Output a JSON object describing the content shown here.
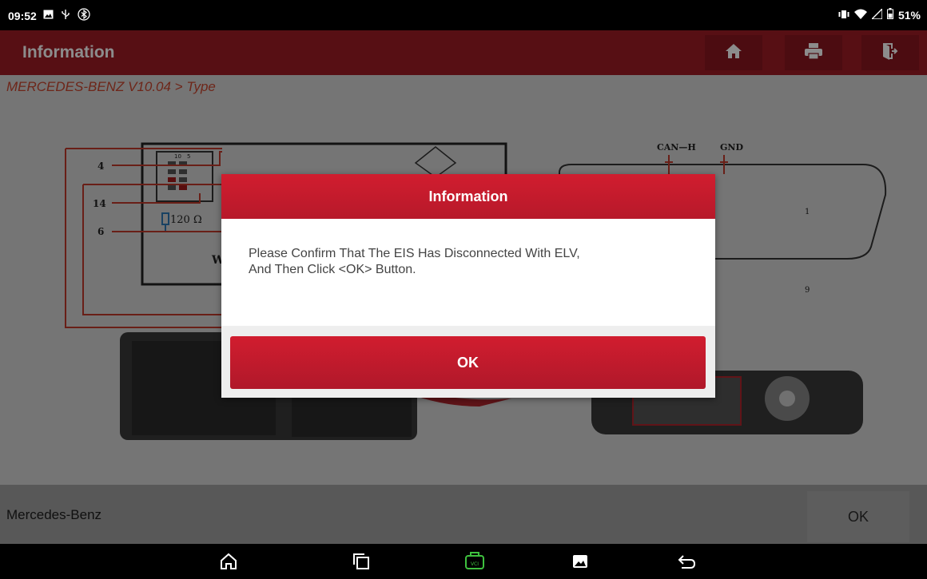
{
  "status_bar": {
    "time": "09:52",
    "battery": "51%",
    "icons_left": [
      "image-icon",
      "usb-icon",
      "bluetooth-icon"
    ],
    "icons_right": [
      "vibrate-icon",
      "wifi-icon",
      "signal-icon",
      "battery-icon"
    ]
  },
  "header": {
    "title": "Information",
    "buttons": [
      "home-icon",
      "print-icon",
      "exit-icon"
    ]
  },
  "breadcrumb": "MERCEDES-BENZ V10.04 > Type",
  "diagram": {
    "pins": [
      "4",
      "14",
      "6"
    ],
    "connector_pin_top": [
      "10",
      "5"
    ],
    "resistor": "120 Ω",
    "obd_labels": [
      "CAN—H",
      "GND"
    ],
    "obd_pins": [
      "1",
      "9"
    ],
    "module_letter": "W"
  },
  "dialog": {
    "title": "Information",
    "message_line1": "Please Confirm That The EIS Has Disconnected With ELV,",
    "message_line2": "And Then Click <OK> Button.",
    "ok_label": "OK"
  },
  "bottom_bar": {
    "vehicle": "Mercedes-Benz",
    "ok_label": "OK"
  },
  "nav_bar": {
    "items": [
      "home-icon",
      "recent-apps-icon",
      "vci-icon",
      "gallery-icon",
      "back-icon"
    ],
    "vci_label": "VCI"
  },
  "colors": {
    "header": "#9e1c26",
    "dialog_accent": "#c81b2d",
    "breadcrumb": "#c8452f",
    "vci": "#3ec13e"
  }
}
